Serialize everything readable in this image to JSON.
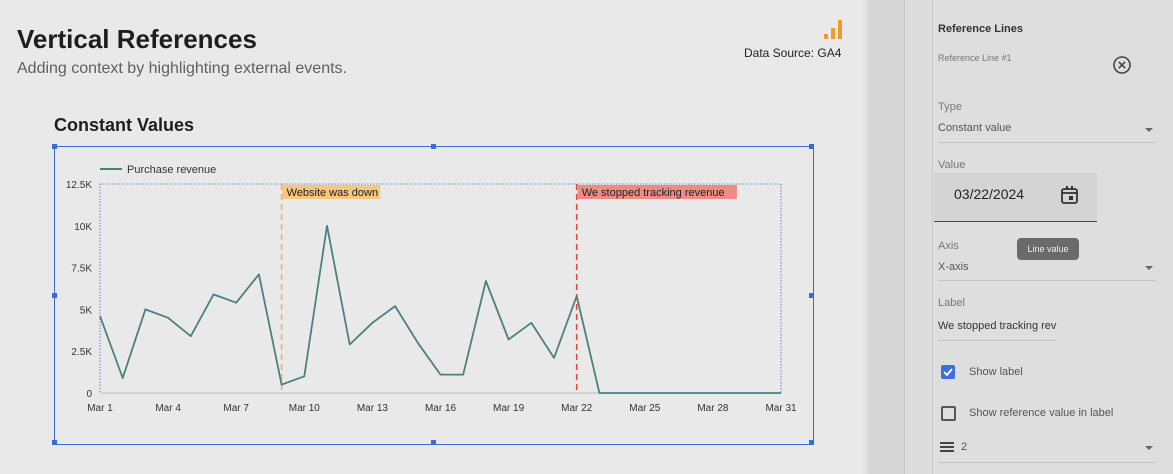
{
  "report": {
    "title": "Vertical References",
    "subtitle": "Adding context by highlighting external events.",
    "data_source": "Data Source: GA4",
    "icon": "bar-chart-icon",
    "accent": "#f29a22"
  },
  "chart": {
    "title": "Constant Values",
    "legend": "Purchase revenue",
    "series_color": "#4d8178",
    "ref_lines": [
      {
        "label": "Website was down",
        "x_index": 8,
        "color": "#f2b35a",
        "bg": "#f6c77e"
      },
      {
        "label": "We stopped tracking revenue",
        "x_index": 21,
        "color": "#e04a42",
        "bg": "#ee8c84"
      }
    ]
  },
  "chart_data": {
    "type": "line",
    "title": "Constant Values",
    "series": [
      {
        "name": "Purchase revenue",
        "values": [
          4600,
          900,
          5000,
          4500,
          3400,
          5900,
          5400,
          7100,
          500,
          1000,
          10000,
          2900,
          4200,
          5200,
          3000,
          1100,
          1100,
          6700,
          3200,
          4200,
          2100,
          5800,
          0,
          0,
          0,
          0,
          0,
          0,
          0,
          0,
          0
        ]
      }
    ],
    "x": [
      "Mar 1",
      "Mar 2",
      "Mar 3",
      "Mar 4",
      "Mar 5",
      "Mar 6",
      "Mar 7",
      "Mar 8",
      "Mar 9",
      "Mar 10",
      "Mar 11",
      "Mar 12",
      "Mar 13",
      "Mar 14",
      "Mar 15",
      "Mar 16",
      "Mar 17",
      "Mar 18",
      "Mar 19",
      "Mar 20",
      "Mar 21",
      "Mar 22",
      "Mar 23",
      "Mar 24",
      "Mar 25",
      "Mar 26",
      "Mar 27",
      "Mar 28",
      "Mar 29",
      "Mar 30",
      "Mar 31"
    ],
    "x_ticks": [
      "Mar 1",
      "Mar 4",
      "Mar 7",
      "Mar 10",
      "Mar 13",
      "Mar 16",
      "Mar 19",
      "Mar 22",
      "Mar 25",
      "Mar 28",
      "Mar 31"
    ],
    "y_ticks": [
      "0",
      "2.5K",
      "5K",
      "7.5K",
      "10K",
      "12.5K"
    ],
    "ylim": [
      0,
      12500
    ],
    "legend_position": "top-left",
    "reference_lines": [
      {
        "x": "Mar 9",
        "label": "Website was down"
      },
      {
        "x": "Mar 22",
        "label": "We stopped tracking revenue"
      }
    ]
  },
  "panel": {
    "section_title": "Reference Lines",
    "ref_line_name": "Reference Line #1",
    "type_label": "Type",
    "type_value": "Constant value",
    "value_label": "Value",
    "value_date": "03/22/2024",
    "tooltip": "Line value",
    "axis_label": "Axis",
    "axis_value": "X-axis",
    "label_label": "Label",
    "label_value": "We stopped tracking rev",
    "show_label": "Show label",
    "show_ref_value": "Show reference value in label",
    "weight_value": "2",
    "checkbox_color": "#3d6fdb"
  }
}
